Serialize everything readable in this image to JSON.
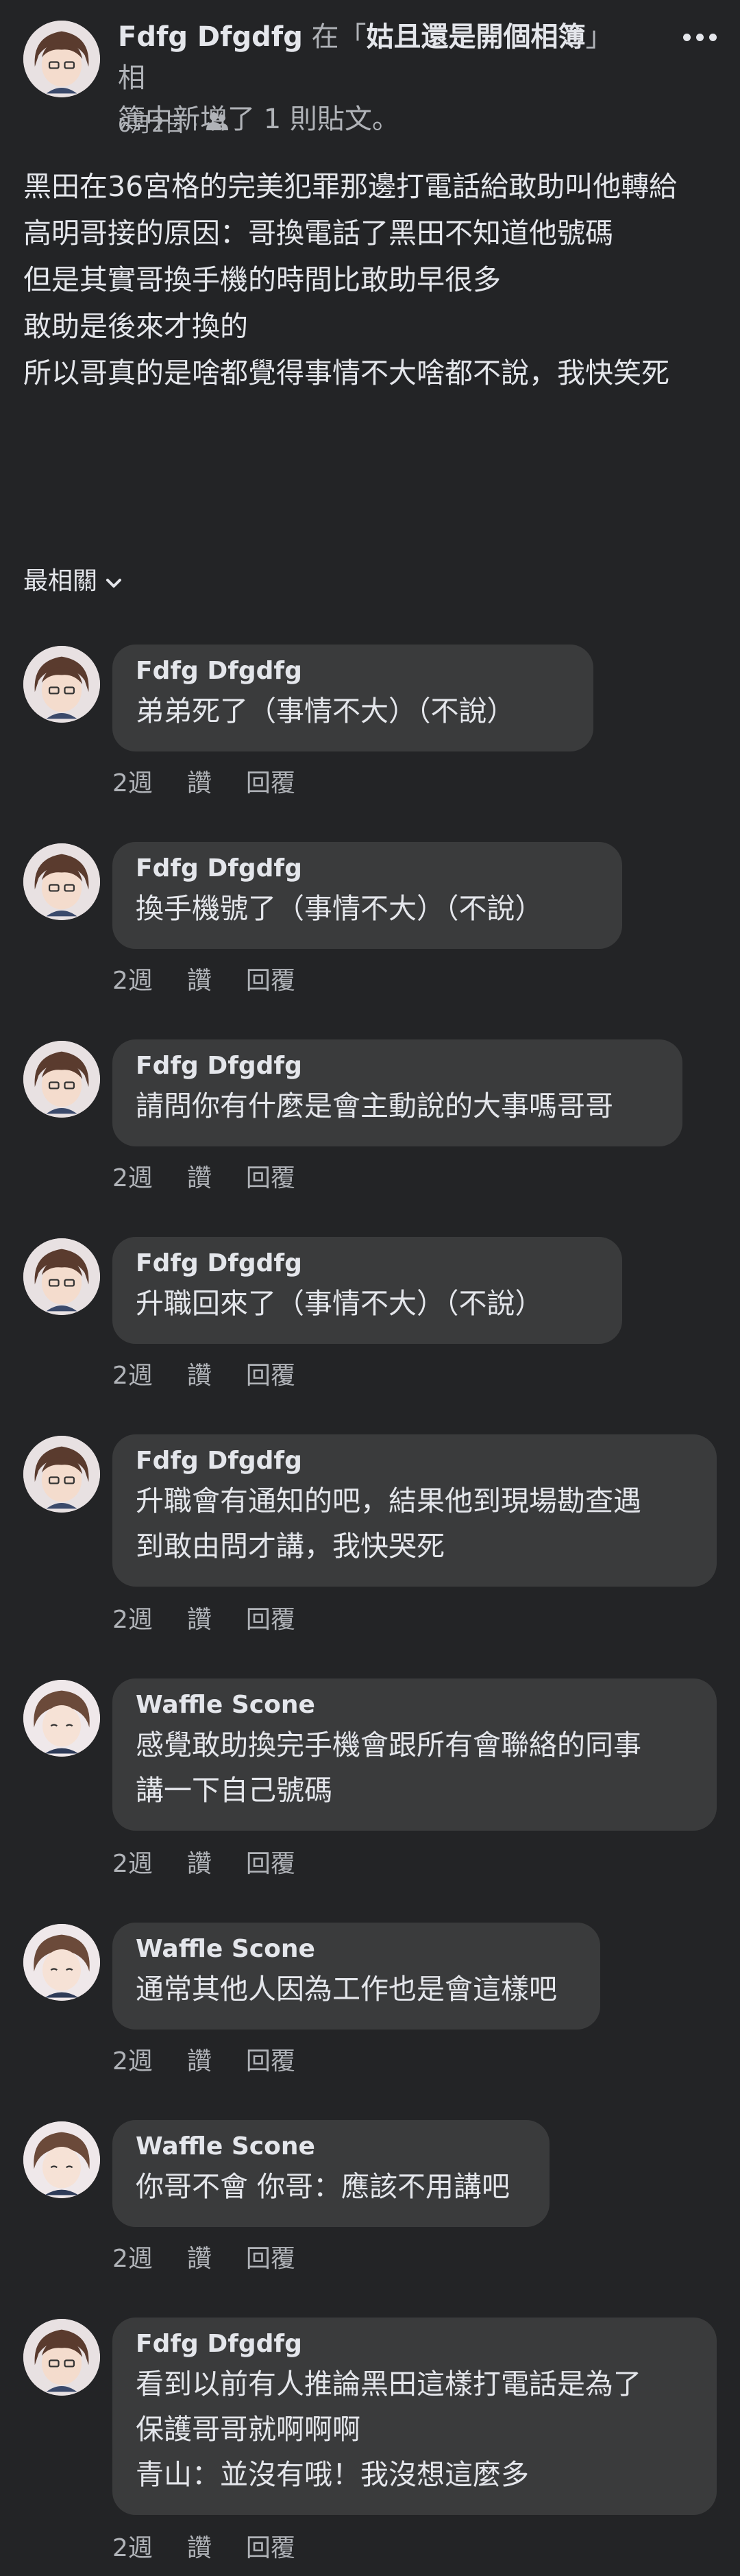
{
  "post": {
    "author": "Fdfg Dfgdfg",
    "title_in": " 在「",
    "album": "姑且還是開個相簿",
    "title_line1_end": "」相",
    "title_line2": "簿中新增了 1 則貼文。",
    "date": "6月2日",
    "dot": "·",
    "privacy_icon": "friends-icon",
    "more_icon": "more-icon",
    "body": [
      "黑田在36宮格的完美犯罪那邊打電話給敢助叫他轉給",
      "高明哥接的原因：哥換電話了黑田不知道他號碼",
      "",
      "但是其實哥換手機的時間比敢助早很多",
      "敢助是後來才換的",
      "所以哥真的是啥都覺得事情不大啥都不說，我快笑死"
    ]
  },
  "sort": {
    "label": "最相關",
    "icon": "chevron-down-icon"
  },
  "comments": [
    {
      "author": "Fdfg Dfgdfg",
      "text": "弟弟死了（事情不大）（不說）",
      "time": "2週",
      "like": "讚",
      "reply": "回覆"
    },
    {
      "author": "Fdfg Dfgdfg",
      "text": "換手機號了（事情不大）（不說）",
      "time": "2週",
      "like": "讚",
      "reply": "回覆"
    },
    {
      "author": "Fdfg Dfgdfg",
      "text": "請問你有什麼是會主動說的大事嗎哥哥",
      "time": "2週",
      "like": "讚",
      "reply": "回覆"
    },
    {
      "author": "Fdfg Dfgdfg",
      "text": "升職回來了（事情不大）（不說）",
      "time": "2週",
      "like": "讚",
      "reply": "回覆"
    },
    {
      "author": "Fdfg Dfgdfg",
      "text": "升職會有通知的吧，結果他到現場勘查遇\n到敢由問才講，我快哭死",
      "time": "2週",
      "like": "讚",
      "reply": "回覆"
    },
    {
      "author": "Waffle Scone",
      "text": "感覺敢助換完手機會跟所有會聯絡的同事\n講一下自己號碼",
      "time": "2週",
      "like": "讚",
      "reply": "回覆"
    },
    {
      "author": "Waffle Scone",
      "text": "通常其他人因為工作也是會這樣吧",
      "time": "2週",
      "like": "讚",
      "reply": "回覆"
    },
    {
      "author": "Waffle Scone",
      "text": "你哥不會 你哥：應該不用講吧",
      "time": "2週",
      "like": "讚",
      "reply": "回覆"
    },
    {
      "author": "Fdfg Dfgdfg",
      "text": "看到以前有人推論黑田這樣打電話是為了\n保護哥哥就啊啊啊\n青山：並沒有哦！我沒想這麼多",
      "time": "2週",
      "like": "讚",
      "reply": "回覆"
    }
  ]
}
